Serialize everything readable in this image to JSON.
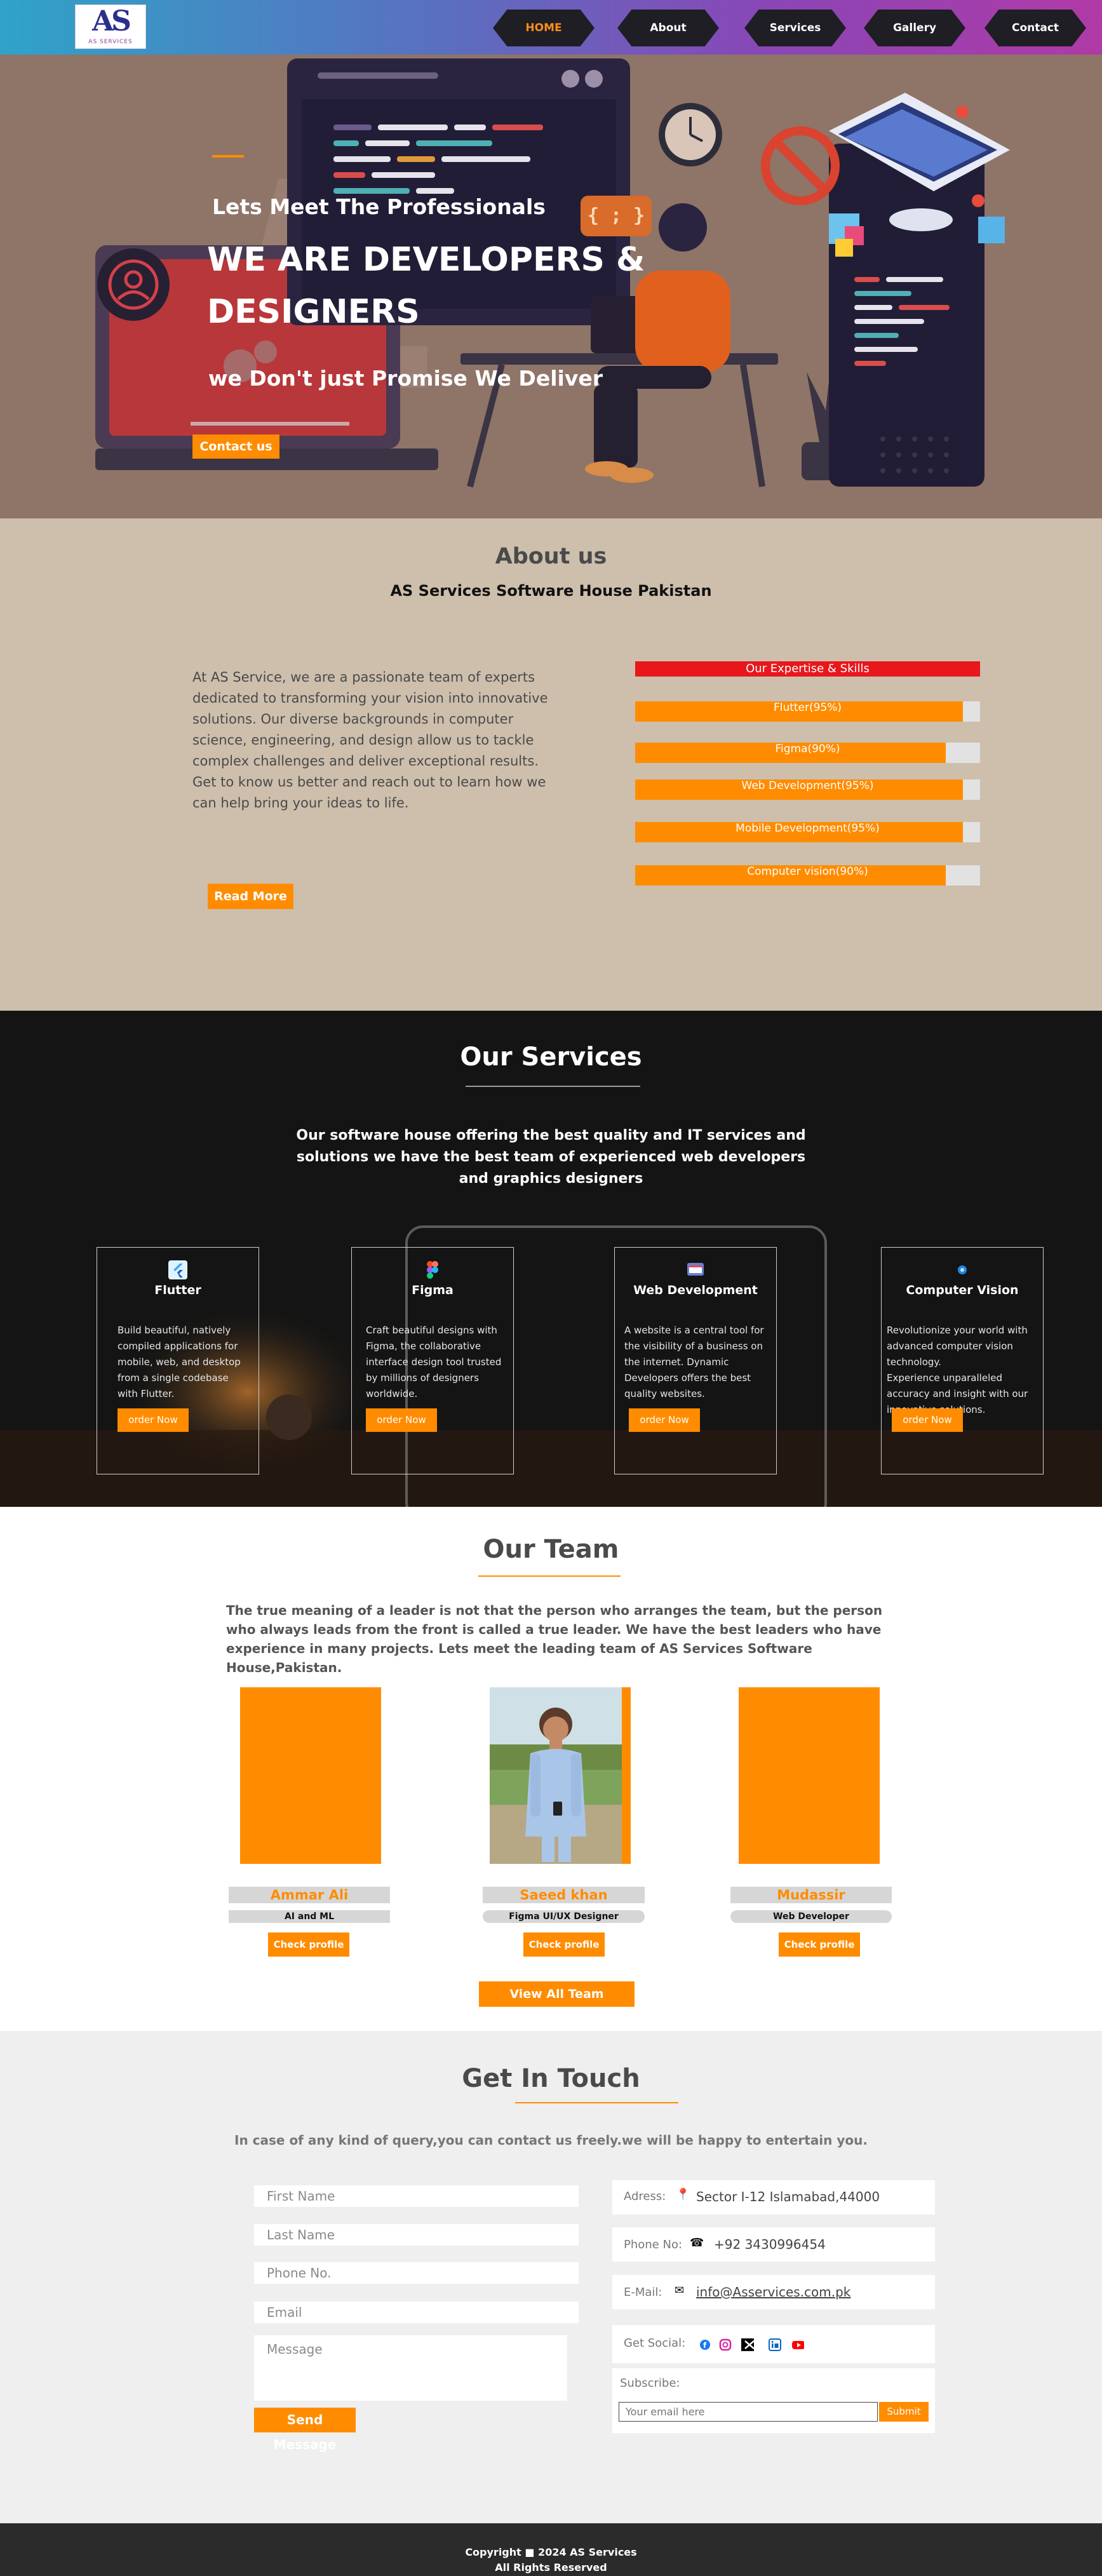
{
  "nav": {
    "logo_text": "AS",
    "logo_sub": "AS SERVICES",
    "items": [
      {
        "label": "HOME",
        "active": true
      },
      {
        "label": "About",
        "active": false
      },
      {
        "label": "Services",
        "active": false
      },
      {
        "label": "Gallery",
        "active": false
      },
      {
        "label": "Contact",
        "active": false
      }
    ]
  },
  "hero": {
    "eyebrow": "Lets Meet The Professionals",
    "title": "WE ARE DEVELOPERS & DESIGNERS",
    "tagline": "we Don't just Promise We Deliver",
    "cta": "Contact us",
    "code_badge": "{ ; }"
  },
  "about": {
    "title": "About us",
    "subtitle": "AS Services Software House Pakistan",
    "paragraph1": "At AS Service, we are a passionate team of experts dedicated to transforming your vision into innovative solutions. Our diverse backgrounds in computer science, engineering, and design allow us to tackle complex challenges and deliver exceptional results.",
    "paragraph2": "Get to know us better and reach out to learn how we can help bring your ideas to life.",
    "cta": "Read More",
    "skills_heading": "Our Expertise & Skills",
    "skills": [
      {
        "label": "Flutter(95%)",
        "level": 95
      },
      {
        "label": "Figma(90%)",
        "level": 90
      },
      {
        "label": "Web Development(95%)",
        "level": 95
      },
      {
        "label": "Mobile Development(95%)",
        "level": 95
      },
      {
        "label": "Computer vision(90%)",
        "level": 90
      }
    ]
  },
  "services": {
    "title": "Our Services",
    "intro": "Our software house offering the best quality and IT services and solutions we have the best team  of experienced web developers and graphics designers",
    "cards": [
      {
        "name": "Flutter",
        "icon": "flutter-icon",
        "lines": [
          "Build beautiful, natively",
          "compiled applications for",
          "mobile, web, and desktop",
          "from a single codebase",
          "with Flutter."
        ],
        "button": "order Now"
      },
      {
        "name": "Figma",
        "icon": "figma-icon",
        "lines": [
          "Craft beautiful designs with",
          "Figma, the collaborative",
          "interface design tool trusted",
          "by millions of designers",
          "worldwide."
        ],
        "button": "order Now"
      },
      {
        "name": "Web Development",
        "icon": "web-icon",
        "lines": [
          "A website is a central tool for",
          "the visibility of a business on",
          "the internet. Dynamic",
          "Developers offers the best",
          "quality websites."
        ],
        "button": "order Now"
      },
      {
        "name": "Computer Vision",
        "icon": "vision-icon",
        "lines": [
          "Revolutionize your world with",
          "advanced computer vision",
          " technology.",
          "Experience unparalleled",
          "accuracy and insight with our",
          "innovative solutions."
        ],
        "button": "order Now"
      }
    ]
  },
  "team": {
    "title": "Our Team",
    "intro": "The true meaning of a leader is not that the person who arranges the team, but the person who always leads from the front is called a true leader. We have the best leaders who have experience in many projects. Lets meet the leading team of AS Services Software House,Pakistan.",
    "members": [
      {
        "name": "Ammar Ali",
        "role": "AI and ML",
        "button": "Check profile"
      },
      {
        "name": "Saeed khan",
        "role": "Figma UI/UX Designer",
        "button": "Check profile"
      },
      {
        "name": "Mudassir",
        "role": "Web Developer",
        "button": "Check profile"
      }
    ],
    "view_all": "View All Team Members"
  },
  "contact": {
    "title": "Get  In Touch",
    "intro": "In case of any kind of query,you can contact us freely.we will be happy to entertain you.",
    "form": {
      "first_name": "First Name",
      "last_name": "Last Name",
      "phone": "Phone No.",
      "email": "Email",
      "message": "Message",
      "send": "Send Message"
    },
    "info": {
      "address_label": "Adress:",
      "address": "Sector I-12 Islamabad,44000",
      "phone_label": "Phone No:",
      "phone": "+92 3430996454",
      "email_label": "E-Mail:",
      "email": "info@Asservices.com.pk",
      "social_label": "Get Social:",
      "subscribe_label": "Subscribe:",
      "subscribe_placeholder": "Your email here",
      "subscribe_button": "Submit"
    }
  },
  "footer": {
    "line1": "Copyright  ■  2024 AS Services",
    "line2": "All Rights Reserved"
  },
  "colors": {
    "accent": "#ff8c00",
    "skills_header": "#e8171c",
    "nav_start": "#2fa3c8",
    "nav_end": "#b03aa6",
    "services_bg": "#141414",
    "about_bg": "#cdbfac"
  }
}
